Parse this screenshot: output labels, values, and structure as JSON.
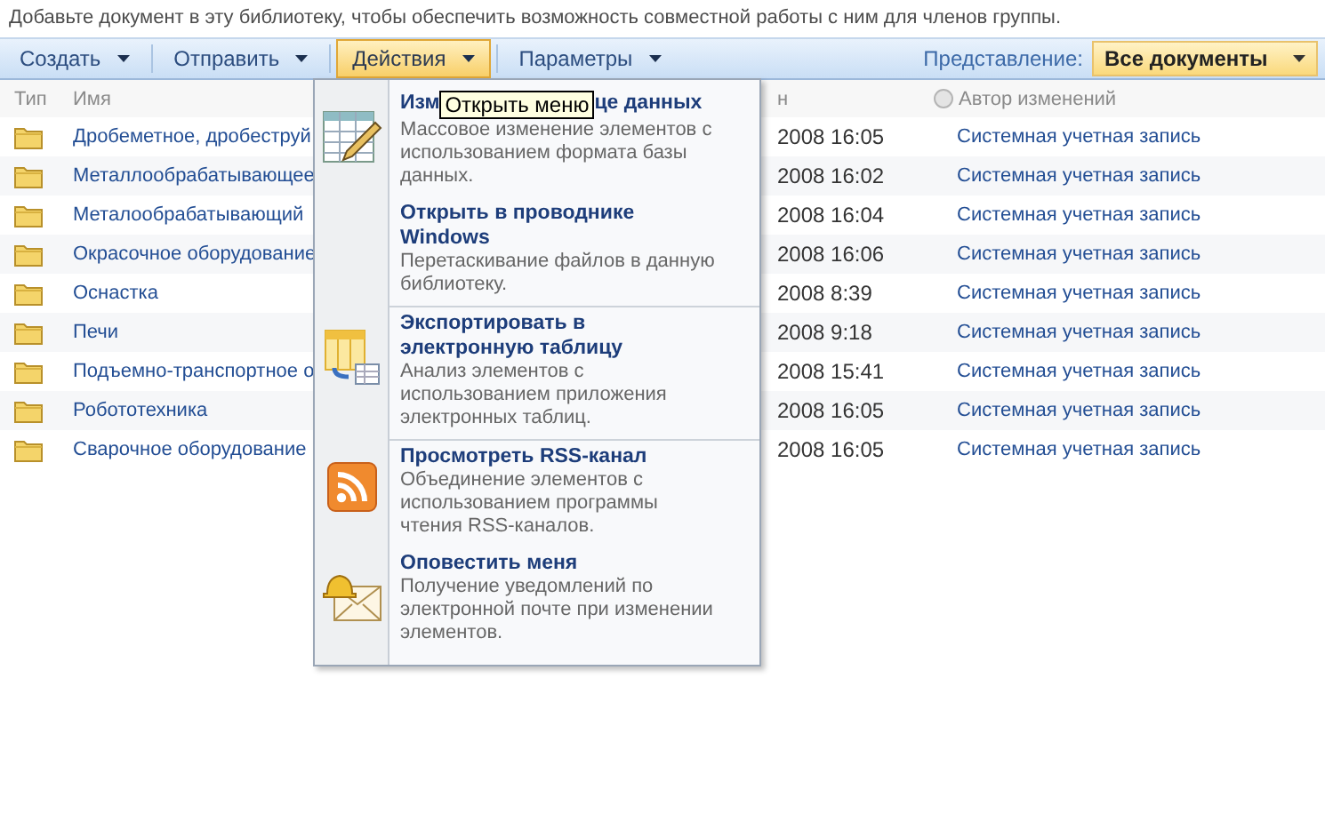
{
  "description": "Добавьте документ в эту библиотеку, чтобы обеспечить возможность совместной работы с ним для членов группы.",
  "toolbar": {
    "menus": [
      {
        "label": "Создать",
        "selected": false
      },
      {
        "label": "Отправить",
        "selected": false
      },
      {
        "label": "Действия",
        "selected": true
      },
      {
        "label": "Параметры",
        "selected": false
      }
    ],
    "view_label": "Представление:",
    "view": "Все документы"
  },
  "table": {
    "columns": [
      "Тип",
      "Имя",
      "н",
      "Автор изменений"
    ],
    "rows": [
      {
        "name": "Дробеметное, дробеструй",
        "column_3": "2008 16:05",
        "author": "Системная учетная запись"
      },
      {
        "name": "Металлообрабатывающее",
        "column_3": "2008 16:02",
        "author": "Системная учетная запись"
      },
      {
        "name": "Металообрабатывающий",
        "column_3": "2008 16:04",
        "author": "Системная учетная запись"
      },
      {
        "name": "Окрасочное оборудование",
        "column_3": "2008 16:06",
        "author": "Системная учетная запись"
      },
      {
        "name": "Оснастка",
        "column_3": "2008 8:39",
        "author": "Системная учетная запись"
      },
      {
        "name": "Печи",
        "column_3": "2008 9:18",
        "author": "Системная учетная запись"
      },
      {
        "name": "Подъемно-транспортное о",
        "column_3": "2008 15:41",
        "author": "Системная учетная запись"
      },
      {
        "name": "Робототехника",
        "column_3": "2008 16:05",
        "author": "Системная учетная запись"
      },
      {
        "name": "Сварочное оборудование",
        "column_3": "2008 16:05",
        "author": "Системная учетная запись"
      }
    ]
  },
  "menu": {
    "tooltip": "Открыть меню",
    "items": [
      {
        "kind": "table-edit",
        "title": "Изм",
        "title_after_tooltip": "це данных",
        "description": "Массовое изменение элементов с использованием формата базы данных."
      },
      {
        "kind": "none",
        "title": "Открыть в проводнике Windows",
        "description": "Перетаскивание файлов в данную библиотеку."
      },
      {
        "kind": "export",
        "title": "Экспортировать в электронную таблицу",
        "description": "Анализ элементов с использованием приложения электронных таблиц."
      },
      {
        "kind": "rss",
        "title": "Просмотреть RSS-канал",
        "description": "Объединение элементов с использованием программы чтения RSS-каналов."
      },
      {
        "kind": "alert",
        "title": "Оповестить меня",
        "description": "Получение уведомлений по электронной почте при изменении элементов."
      }
    ]
  }
}
